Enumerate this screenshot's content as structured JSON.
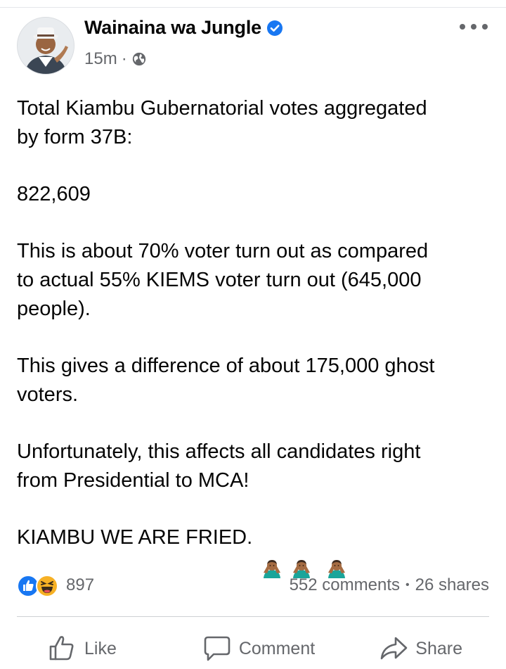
{
  "post": {
    "author": "Wainaina wa Jungle",
    "verified": true,
    "time": "15m",
    "meta_separator": "·",
    "privacy_icon": "globe-icon",
    "paragraphs": [
      "Total Kiambu Gubernatorial votes aggregated\nby form 37B:",
      "822,609",
      "This is about 70% voter turn out as compared\nto actual 55% KIEMS voter turn out (645,000\npeople).",
      "This gives a difference of about 175,000 ghost\nvoters.",
      "Unfortunately, this affects all candidates right\nfrom Presidential to MCA!"
    ],
    "closing_line": "KIAMBU WE ARE FRIED.",
    "closing_emojis": [
      "person-gesturing-no-emoji",
      "person-gesturing-no-emoji",
      "person-gesturing-no-emoji"
    ]
  },
  "reactions": {
    "icons": [
      "like-reaction-icon",
      "haha-reaction-icon"
    ],
    "count": "897",
    "comments": "552 comments",
    "separator": "•",
    "shares": "26 shares"
  },
  "actions": {
    "like": "Like",
    "comment": "Comment",
    "share": "Share"
  },
  "colors": {
    "brand_blue": "#1877f2",
    "text_primary": "#050505",
    "text_secondary": "#65676b",
    "divider": "#ced0d4",
    "haha_yellow": "#f7b125",
    "emoji_shirt": "#1aa59a",
    "emoji_skin": "#a56c43"
  }
}
